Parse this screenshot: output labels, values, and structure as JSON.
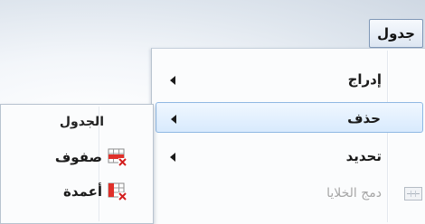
{
  "menubar": {
    "table_label": "جدول"
  },
  "menu": {
    "items": [
      {
        "label": "إدراج",
        "has_submenu": true,
        "state": "normal"
      },
      {
        "label": "حذف",
        "has_submenu": true,
        "state": "hover"
      },
      {
        "label": "تحديد",
        "has_submenu": true,
        "state": "normal"
      },
      {
        "label": "دمج الخلايا",
        "has_submenu": false,
        "state": "disabled",
        "icon": "merge-cells-icon"
      }
    ]
  },
  "submenu": {
    "header": "الجدول",
    "items": [
      {
        "label": "صفوف",
        "icon": "delete-rows-icon"
      },
      {
        "label": "أعمدة",
        "icon": "delete-columns-icon"
      }
    ]
  },
  "colors": {
    "hover_border": "#8fb8e3",
    "hover_fill": "#d8eafd",
    "icon_red": "#e0302a",
    "disabled_text": "#a6a6a6"
  }
}
